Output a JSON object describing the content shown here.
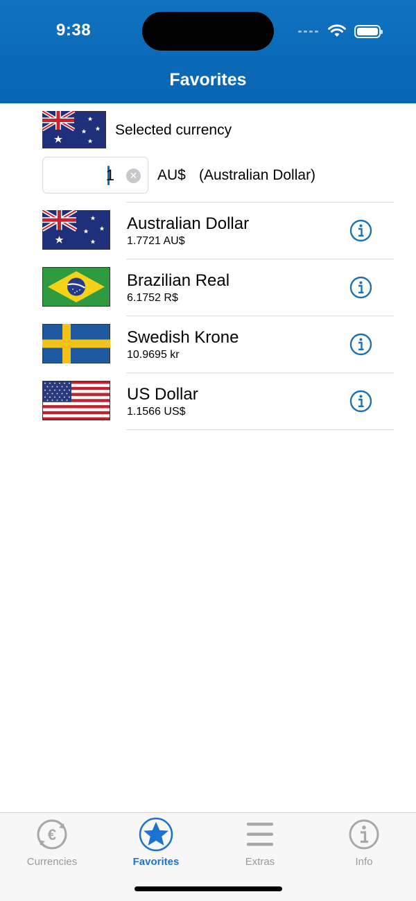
{
  "status_bar": {
    "time": "9:38"
  },
  "nav": {
    "title": "Favorites"
  },
  "selected": {
    "label": "Selected currency",
    "amount": "1",
    "code": "AU$",
    "name": "(Australian Dollar)",
    "flag": "australia-flag"
  },
  "currencies": [
    {
      "name": "Australian Dollar",
      "rate": "1.7721 AU$",
      "flag": "australia-flag"
    },
    {
      "name": "Brazilian Real",
      "rate": "6.1752 R$",
      "flag": "brazil-flag"
    },
    {
      "name": "Swedish Krone",
      "rate": "10.9695 kr",
      "flag": "sweden-flag"
    },
    {
      "name": "US Dollar",
      "rate": "1.1566 US$",
      "flag": "usa-flag"
    }
  ],
  "tabs": [
    {
      "label": "Currencies",
      "icon": "euro-exchange-icon",
      "active": false
    },
    {
      "label": "Favorites",
      "icon": "star-icon",
      "active": true
    },
    {
      "label": "Extras",
      "icon": "menu-lines-icon",
      "active": false
    },
    {
      "label": "Info",
      "icon": "info-icon",
      "active": false
    }
  ],
  "colors": {
    "header": "#0a6ebd",
    "accent": "#1a73d0",
    "info": "#1a73b8",
    "tab_inactive": "#9a9a9a"
  }
}
